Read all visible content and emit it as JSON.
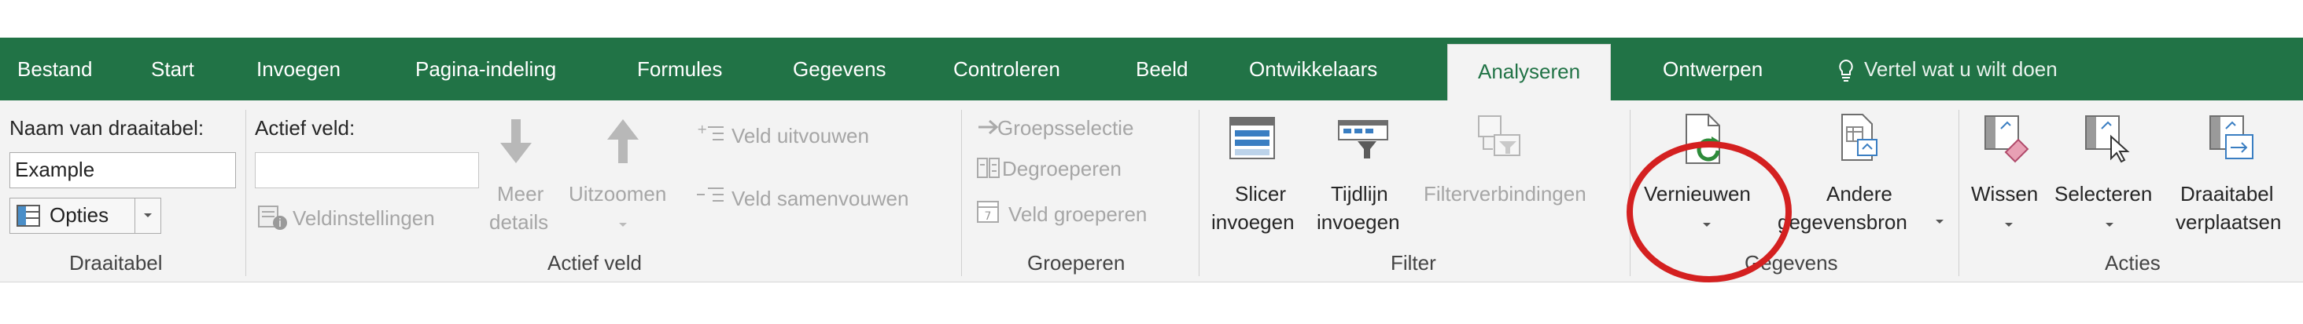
{
  "tabs": [
    {
      "label": "Bestand"
    },
    {
      "label": "Start"
    },
    {
      "label": "Invoegen"
    },
    {
      "label": "Pagina-indeling"
    },
    {
      "label": "Formules"
    },
    {
      "label": "Gegevens"
    },
    {
      "label": "Controleren"
    },
    {
      "label": "Beeld"
    },
    {
      "label": "Ontwikkelaars"
    },
    {
      "label": "Analyseren",
      "active": true
    },
    {
      "label": "Ontwerpen"
    }
  ],
  "tell_me": {
    "label": "Vertel wat u wilt doen",
    "icon": "lightbulb-icon"
  },
  "groups": {
    "draaitabel": {
      "title": "Draaitabel",
      "name_label": "Naam van draaitabel:",
      "name_value": "Example",
      "opties_label": "Opties"
    },
    "actief_veld": {
      "title": "Actief veld",
      "field_label": "Actief veld:",
      "field_value": "",
      "veldinstellingen_label": "Veldinstellingen",
      "meer_details_line1": "Meer",
      "meer_details_line2": "details",
      "uitzoomen_label": "Uitzoomen",
      "veld_uitvouwen_label": "Veld uitvouwen",
      "veld_samenvouwen_label": "Veld samenvouwen"
    },
    "groeperen": {
      "title": "Groeperen",
      "groepsselectie_label": "Groepsselectie",
      "degroeperen_label": "Degroeperen",
      "veld_groeperen_label": "Veld groeperen"
    },
    "filter": {
      "title": "Filter",
      "slicer_line1": "Slicer",
      "slicer_line2": "invoegen",
      "tijdlijn_line1": "Tijdlijn",
      "tijdlijn_line2": "invoegen",
      "filterverbindingen_label": "Filterverbindingen"
    },
    "gegevens": {
      "title": "Gegevens",
      "vernieuwen_label": "Vernieuwen",
      "andere_line1": "Andere",
      "andere_line2": "gegevensbron"
    },
    "acties": {
      "title": "Acties",
      "wissen_label": "Wissen",
      "selecteren_label": "Selecteren",
      "draaitabel_line1": "Draaitabel",
      "draaitabel_line2": "verplaatsen"
    }
  },
  "colors": {
    "tab_bar": "#217346",
    "ribbon": "#f3f3f3",
    "highlight_circle": "#d42020"
  }
}
